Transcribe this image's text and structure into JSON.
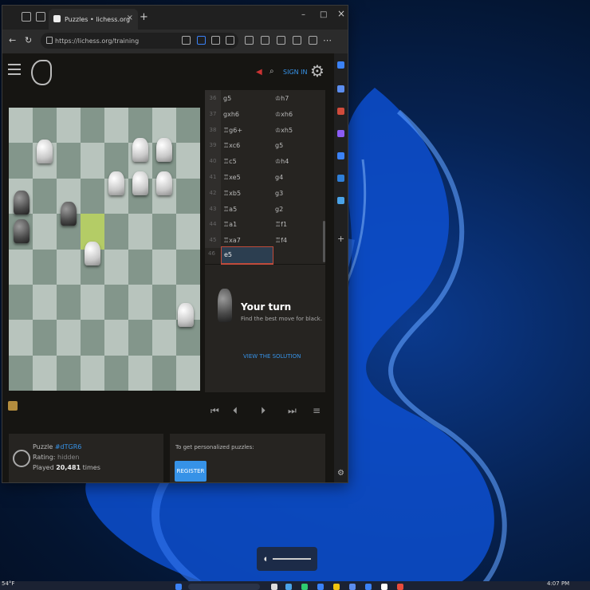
{
  "browser": {
    "tab_title": "Puzzles • lichess.org",
    "url": "https://lichess.org/training",
    "url_domain": "lichess.org",
    "new_tab_label": "+",
    "minimize": "–",
    "maximize": "□",
    "close": "×"
  },
  "header": {
    "signin": "SIGN IN"
  },
  "moves": [
    {
      "n": "36",
      "w": "g5",
      "b": "♔h7"
    },
    {
      "n": "37",
      "w": "gxh6",
      "b": "♔xh6"
    },
    {
      "n": "38",
      "w": "♖g6+",
      "b": "♔xh5"
    },
    {
      "n": "39",
      "w": "♖xc6",
      "b": "g5"
    },
    {
      "n": "40",
      "w": "♖c5",
      "b": "♔h4"
    },
    {
      "n": "41",
      "w": "♖xe5",
      "b": "g4"
    },
    {
      "n": "42",
      "w": "♖xb5",
      "b": "g3"
    },
    {
      "n": "43",
      "w": "♖a5",
      "b": "g2"
    },
    {
      "n": "44",
      "w": "♖a1",
      "b": "♖f1"
    },
    {
      "n": "45",
      "w": "♖xa7",
      "b": "♖f4"
    }
  ],
  "current_move": {
    "n": "46",
    "w": "e5"
  },
  "turn": {
    "heading": "Your turn",
    "subtitle": "Find the best move for black.",
    "solution": "VIEW THE SOLUTION"
  },
  "controls": {
    "first": "⏮",
    "prev": "⏴",
    "next": "⏵",
    "last": "⏭",
    "menu": "≡"
  },
  "puzzle": {
    "label": "Puzzle",
    "id": "#dTGR6",
    "rating_label": "Rating:",
    "rating": "hidden",
    "played_prefix": "Played",
    "played_count": "20,481",
    "played_suffix": "times"
  },
  "register": {
    "prompt": "To get personalized puzzles:",
    "button": "REGISTER"
  },
  "taskbar": {
    "temp": "54°F",
    "time": "4:07 PM"
  },
  "colors": {
    "accent": "#3692e7",
    "board_light": "#b8c4bd",
    "board_dark": "#83968b"
  }
}
